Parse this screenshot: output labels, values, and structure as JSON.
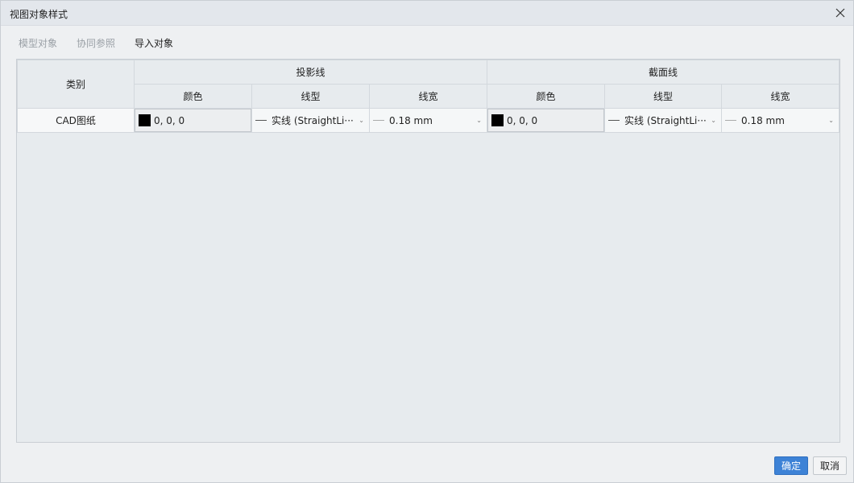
{
  "window": {
    "title": "视图对象样式"
  },
  "tabs": [
    {
      "label": "模型对象"
    },
    {
      "label": "协同参照"
    },
    {
      "label": "导入对象"
    }
  ],
  "table": {
    "header": {
      "category": "类别",
      "projection": "投影线",
      "section": "截面线",
      "color": "颜色",
      "linetype": "线型",
      "lineweight": "线宽"
    },
    "rows": [
      {
        "category": "CAD图纸",
        "projection": {
          "color": "0, 0, 0",
          "linetype": "实线 (StraightLi···",
          "lineweight": "0.18 mm"
        },
        "section": {
          "color": "0, 0, 0",
          "linetype": "实线 (StraightLi···",
          "lineweight": "0.18 mm"
        }
      }
    ]
  },
  "buttons": {
    "ok": "确定",
    "cancel": "取消"
  },
  "colors": {
    "accent": "#3d82d6",
    "swatch": "#000000"
  }
}
